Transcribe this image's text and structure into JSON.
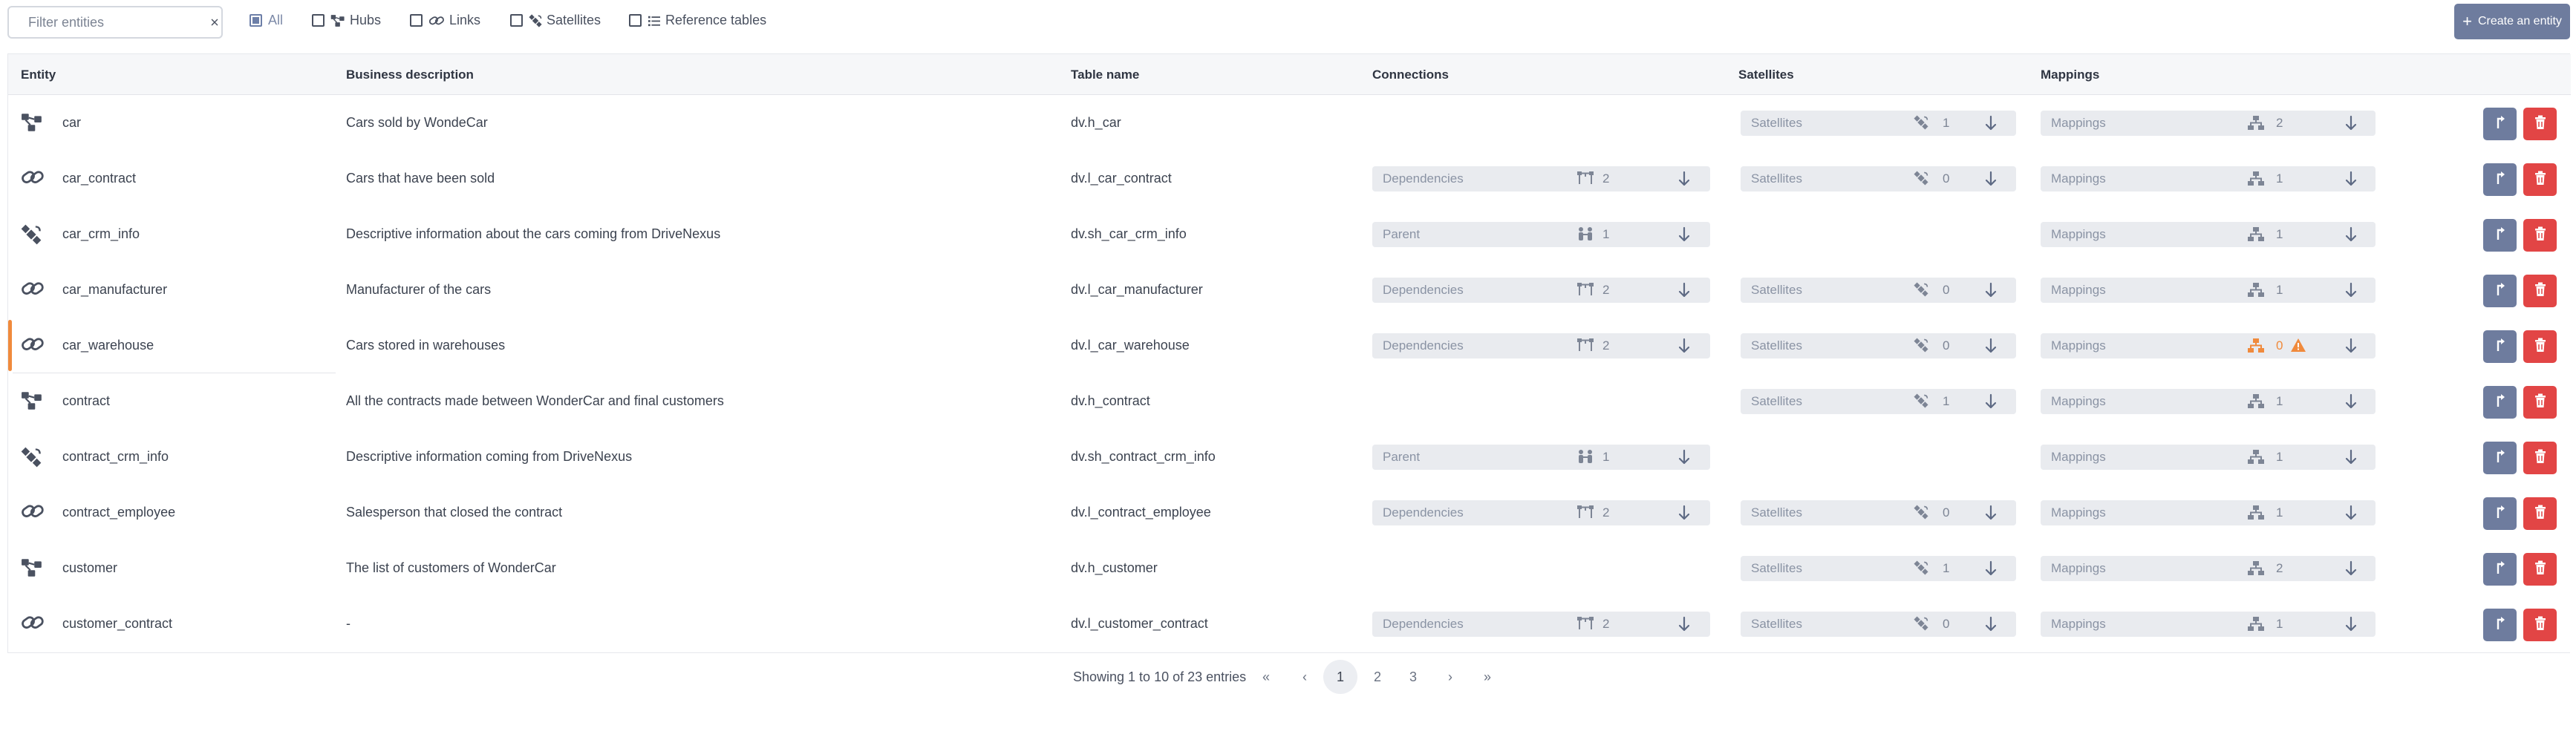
{
  "toolbar": {
    "filter_placeholder": "Filter entities",
    "filters": [
      {
        "label": "All",
        "checked": true
      },
      {
        "label": "Hubs",
        "checked": false
      },
      {
        "label": "Links",
        "checked": false
      },
      {
        "label": "Satellites",
        "checked": false
      },
      {
        "label": "Reference tables",
        "checked": false
      }
    ],
    "create_label": "Create an entity"
  },
  "columns": {
    "entity": "Entity",
    "description": "Business description",
    "table": "Table name",
    "connections": "Connections",
    "satellites": "Satellites",
    "mappings": "Mappings"
  },
  "rows": [
    {
      "type": "hub",
      "name": "car",
      "description": "Cars sold by WondeCar",
      "table": "dv.h_car",
      "connections": null,
      "satellites": {
        "label": "Satellites",
        "count": "1"
      },
      "mappings": {
        "label": "Mappings",
        "count": "2",
        "warning": false
      }
    },
    {
      "type": "link",
      "name": "car_contract",
      "description": "Cars that have been sold",
      "table": "dv.l_car_contract",
      "connections": {
        "label": "Dependencies",
        "count": "2",
        "kind": "dependencies"
      },
      "satellites": {
        "label": "Satellites",
        "count": "0"
      },
      "mappings": {
        "label": "Mappings",
        "count": "1",
        "warning": false
      }
    },
    {
      "type": "satellite",
      "name": "car_crm_info",
      "description": "Descriptive information about the cars coming from DriveNexus",
      "table": "dv.sh_car_crm_info",
      "connections": {
        "label": "Parent",
        "count": "1",
        "kind": "parent"
      },
      "satellites": null,
      "mappings": {
        "label": "Mappings",
        "count": "1",
        "warning": false
      }
    },
    {
      "type": "link",
      "name": "car_manufacturer",
      "description": "Manufacturer of the cars",
      "table": "dv.l_car_manufacturer",
      "connections": {
        "label": "Dependencies",
        "count": "2",
        "kind": "dependencies"
      },
      "satellites": {
        "label": "Satellites",
        "count": "0"
      },
      "mappings": {
        "label": "Mappings",
        "count": "1",
        "warning": false
      }
    },
    {
      "type": "link",
      "name": "car_warehouse",
      "description": "Cars stored in warehouses",
      "table": "dv.l_car_warehouse",
      "connections": {
        "label": "Dependencies",
        "count": "2",
        "kind": "dependencies"
      },
      "satellites": {
        "label": "Satellites",
        "count": "0"
      },
      "mappings": {
        "label": "Mappings",
        "count": "0",
        "warning": true
      },
      "selected": true
    },
    {
      "type": "hub",
      "name": "contract",
      "description": "All the contracts made between WonderCar and final customers",
      "table": "dv.h_contract",
      "connections": null,
      "satellites": {
        "label": "Satellites",
        "count": "1"
      },
      "mappings": {
        "label": "Mappings",
        "count": "1",
        "warning": false
      }
    },
    {
      "type": "satellite",
      "name": "contract_crm_info",
      "description": "Descriptive information coming from DriveNexus",
      "table": "dv.sh_contract_crm_info",
      "connections": {
        "label": "Parent",
        "count": "1",
        "kind": "parent"
      },
      "satellites": null,
      "mappings": {
        "label": "Mappings",
        "count": "1",
        "warning": false
      }
    },
    {
      "type": "link",
      "name": "contract_employee",
      "description": "Salesperson that closed the contract",
      "table": "dv.l_contract_employee",
      "connections": {
        "label": "Dependencies",
        "count": "2",
        "kind": "dependencies"
      },
      "satellites": {
        "label": "Satellites",
        "count": "0"
      },
      "mappings": {
        "label": "Mappings",
        "count": "1",
        "warning": false
      }
    },
    {
      "type": "hub",
      "name": "customer",
      "description": "The list of customers of WonderCar",
      "table": "dv.h_customer",
      "connections": null,
      "satellites": {
        "label": "Satellites",
        "count": "1"
      },
      "mappings": {
        "label": "Mappings",
        "count": "2",
        "warning": false
      }
    },
    {
      "type": "link",
      "name": "customer_contract",
      "description": "-",
      "table": "dv.l_customer_contract",
      "connections": {
        "label": "Dependencies",
        "count": "2",
        "kind": "dependencies"
      },
      "satellites": {
        "label": "Satellites",
        "count": "0"
      },
      "mappings": {
        "label": "Mappings",
        "count": "1",
        "warning": false
      }
    }
  ],
  "pagination": {
    "info": "Showing 1 to 10 of 23 entries",
    "first": "«",
    "prev": "‹",
    "pages": [
      "1",
      "2",
      "3"
    ],
    "current": "1",
    "next": "›",
    "last": "»"
  },
  "colors": {
    "primary": "#6e7c9e",
    "danger": "#e24545",
    "warning": "#f08a3c",
    "pill_bg": "#e9ebef"
  }
}
